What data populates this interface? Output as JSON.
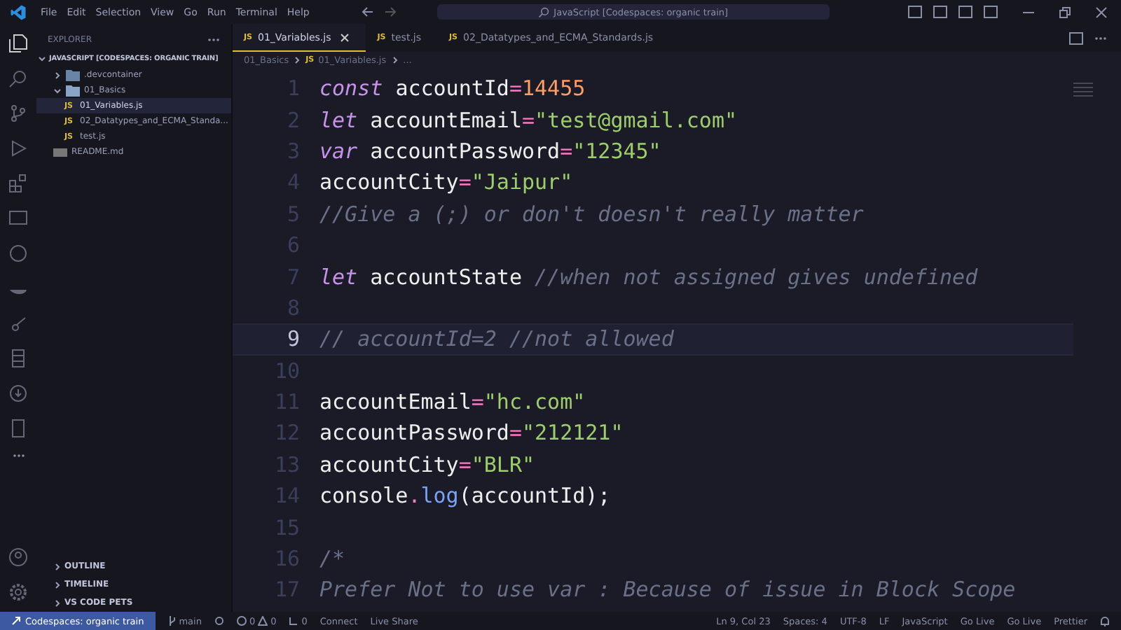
{
  "menu": [
    "File",
    "Edit",
    "Selection",
    "View",
    "Go",
    "Run",
    "Terminal",
    "Help"
  ],
  "command_center": "JavaScript [Codespaces: organic train]",
  "sidebar": {
    "title": "EXPLORER",
    "root": "JAVASCRIPT [CODESPACES: ORGANIC TRAIN]",
    "tree": [
      {
        "label": ".devcontainer",
        "kind": "folder",
        "expanded": false,
        "selected": false
      },
      {
        "label": "01_Basics",
        "kind": "folder",
        "expanded": true,
        "selected": false,
        "children": [
          {
            "label": "01_Variables.js",
            "kind": "js",
            "badge": "JS",
            "selected": true
          },
          {
            "label": "02_Datatypes_and_ECMA_Standa...",
            "kind": "js",
            "badge": "JS",
            "selected": false
          },
          {
            "label": "test.js",
            "kind": "js",
            "badge": "JS",
            "selected": false
          }
        ]
      },
      {
        "label": "README.md",
        "kind": "md",
        "selected": false
      }
    ],
    "sections": [
      "OUTLINE",
      "TIMELINE",
      "VS CODE PETS"
    ]
  },
  "tabs": [
    {
      "badge": "JS",
      "label": "01_Variables.js",
      "selected": true,
      "closable": true
    },
    {
      "badge": "JS",
      "label": "test.js",
      "selected": false,
      "closable": false
    },
    {
      "badge": "JS",
      "label": "02_Datatypes_and_ECMA_Standards.js",
      "selected": false,
      "closable": false
    }
  ],
  "breadcrumbs": [
    {
      "label": "01_Basics"
    },
    {
      "label": "01_Variables.js",
      "badge": "JS"
    },
    {
      "label": "..."
    }
  ],
  "editor": {
    "lines": [
      {
        "number": "1",
        "current": false,
        "tokens": [
          {
            "kind": "keyword",
            "text": "const "
          },
          {
            "kind": "name",
            "text": "accountId"
          },
          {
            "kind": "op",
            "text": "="
          },
          {
            "kind": "number",
            "text": "14455"
          }
        ]
      },
      {
        "number": "2",
        "current": false,
        "tokens": [
          {
            "kind": "keyword",
            "text": "let "
          },
          {
            "kind": "name",
            "text": "accountEmail"
          },
          {
            "kind": "op",
            "text": "="
          },
          {
            "kind": "string",
            "text": "\"test@gmail.com\""
          }
        ]
      },
      {
        "number": "3",
        "current": false,
        "tokens": [
          {
            "kind": "keyword",
            "text": "var "
          },
          {
            "kind": "name",
            "text": "accountPassword"
          },
          {
            "kind": "op",
            "text": "="
          },
          {
            "kind": "string",
            "text": "\"12345\""
          }
        ]
      },
      {
        "number": "4",
        "current": false,
        "tokens": [
          {
            "kind": "name",
            "text": "accountCity"
          },
          {
            "kind": "op",
            "text": "="
          },
          {
            "kind": "string",
            "text": "\"Jaipur\""
          }
        ]
      },
      {
        "number": "5",
        "current": false,
        "tokens": [
          {
            "kind": "comment",
            "text": "//Give a (;) or don't doesn't really matter"
          }
        ]
      },
      {
        "number": "6",
        "current": false
      },
      {
        "number": "7",
        "current": false,
        "tokens": [
          {
            "kind": "keyword",
            "text": "let "
          },
          {
            "kind": "name",
            "text": "accountState "
          },
          {
            "kind": "comment",
            "text": "//when not assigned gives undefined"
          }
        ]
      },
      {
        "number": "8",
        "current": false
      },
      {
        "number": "9",
        "current": true,
        "tokens": [
          {
            "kind": "comment",
            "text": "// accountId=2 //not allowed"
          }
        ]
      },
      {
        "number": "10",
        "current": false
      },
      {
        "number": "11",
        "current": false,
        "tokens": [
          {
            "kind": "name",
            "text": "accountEmail"
          },
          {
            "kind": "op",
            "text": "="
          },
          {
            "kind": "string",
            "text": "\"hc.com\""
          }
        ]
      },
      {
        "number": "12",
        "current": false,
        "tokens": [
          {
            "kind": "name",
            "text": "accountPassword"
          },
          {
            "kind": "op",
            "text": "="
          },
          {
            "kind": "string",
            "text": "\"212121\""
          }
        ]
      },
      {
        "number": "13",
        "current": false,
        "tokens": [
          {
            "kind": "name",
            "text": "accountCity"
          },
          {
            "kind": "op",
            "text": "="
          },
          {
            "kind": "string",
            "text": "\"BLR\""
          }
        ]
      },
      {
        "number": "14",
        "current": false,
        "tokens": [
          {
            "kind": "name",
            "text": "console"
          },
          {
            "kind": "op",
            "text": "."
          },
          {
            "kind": "func",
            "text": "log"
          },
          {
            "kind": "name",
            "text": "(accountId);"
          }
        ]
      },
      {
        "number": "15",
        "current": false
      },
      {
        "number": "16",
        "current": false,
        "tokens": [
          {
            "kind": "comment",
            "text": "/*"
          }
        ]
      },
      {
        "number": "17",
        "current": false,
        "tokens": [
          {
            "kind": "comment",
            "text": "Prefer Not to use var : Because of issue in Block Scope"
          }
        ]
      }
    ]
  },
  "status_bar": {
    "remote": "Codespaces: organic train",
    "branch": "main",
    "errors": "0",
    "warnings": "0",
    "ports": "0",
    "connect": "Connect",
    "live_share": "Live Share",
    "right": [
      "Ln 9, Col 23",
      "Spaces: 4",
      "UTF-8",
      "LF",
      "JavaScript",
      "Go Live",
      "Go Live",
      "Prettier"
    ]
  }
}
